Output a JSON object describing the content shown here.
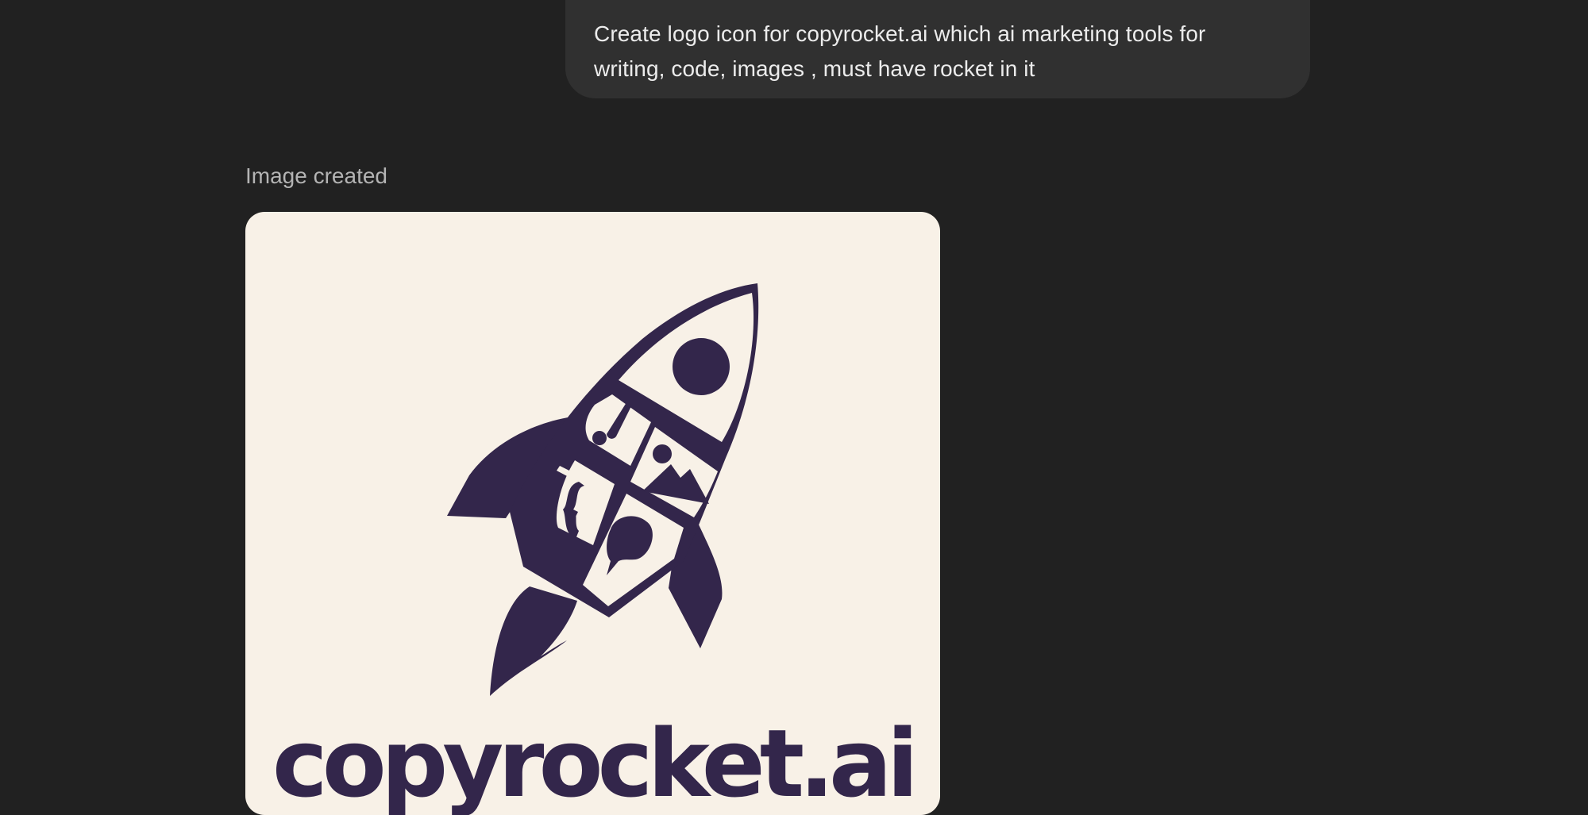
{
  "conversation": {
    "user_message": "Create logo icon for copyrocket.ai which ai marketing tools for writing, code, images , must have rocket in it",
    "status_label": "Image created"
  },
  "generated_image": {
    "wordmark": "copyrocket.ai",
    "colors": {
      "background": "#f8f1e7",
      "ink": "#33264b"
    }
  },
  "theme": {
    "page_background": "#212121",
    "bubble_background": "#303030",
    "bubble_text": "#ececec",
    "muted_text": "#b4b4b4"
  }
}
